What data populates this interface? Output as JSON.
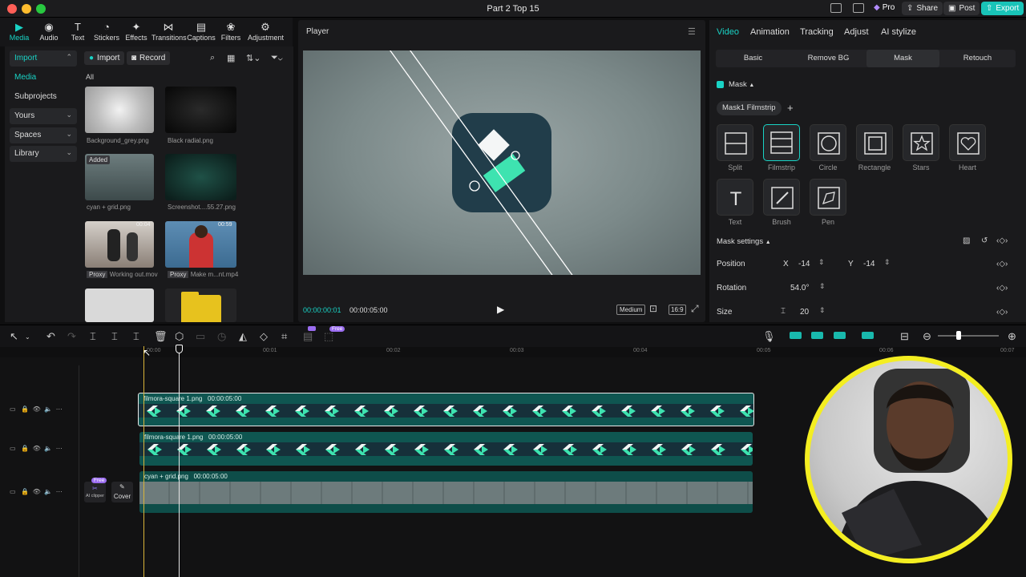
{
  "window": {
    "title": "Part 2 Top 15",
    "pro_label": "Pro",
    "share_label": "Share",
    "post_label": "Post",
    "export_label": "Export"
  },
  "toolbar": {
    "items": [
      {
        "label": "Media",
        "icon": "media-icon"
      },
      {
        "label": "Audio",
        "icon": "audio-icon"
      },
      {
        "label": "Text",
        "icon": "text-icon"
      },
      {
        "label": "Stickers",
        "icon": "stickers-icon"
      },
      {
        "label": "Effects",
        "icon": "effects-icon"
      },
      {
        "label": "Transitions",
        "icon": "transitions-icon"
      },
      {
        "label": "Captions",
        "icon": "captions-icon"
      },
      {
        "label": "Filters",
        "icon": "filters-icon"
      },
      {
        "label": "Adjustment",
        "icon": "adjustment-icon"
      }
    ]
  },
  "sidebar": {
    "items": [
      {
        "label": "Import"
      },
      {
        "label": "Media"
      },
      {
        "label": "Subprojects"
      },
      {
        "label": "Yours"
      },
      {
        "label": "Spaces"
      },
      {
        "label": "Library"
      }
    ]
  },
  "media": {
    "import_label": "Import",
    "record_label": "Record",
    "filter_all": "All",
    "items": [
      {
        "name": "Background_grey.png"
      },
      {
        "name": "Black radial.png"
      },
      {
        "name": "cyan + grid.png",
        "badge": "Added"
      },
      {
        "name": "Screenshot....55.27.png"
      },
      {
        "name": "Working out.mov",
        "badge": "Proxy",
        "duration": "00:04"
      },
      {
        "name": "Make m...nt.mp4",
        "badge": "Proxy",
        "duration": "00:59"
      }
    ]
  },
  "player": {
    "title": "Player",
    "current_time": "00:00:00:01",
    "total_time": "00:00:05:00",
    "quality": "Medium",
    "ratio": "16:9"
  },
  "inspector": {
    "tabs": [
      "Video",
      "Animation",
      "Tracking",
      "Adjust",
      "AI stylize"
    ],
    "subtabs": [
      "Basic",
      "Remove BG",
      "Mask",
      "Retouch"
    ],
    "mask_toggle_label": "Mask",
    "mask_chip": "Mask1 Filmstrip",
    "masks": [
      "Split",
      "Filmstrip",
      "Circle",
      "Rectangle",
      "Stars",
      "Heart",
      "Text",
      "Brush",
      "Pen"
    ],
    "settings_title": "Mask settings",
    "position_label": "Position",
    "x_label": "X",
    "x_value": "-14",
    "y_label": "Y",
    "y_value": "-14",
    "rotation_label": "Rotation",
    "rotation_value": "54.0°",
    "size_label": "Size",
    "size_value": "20"
  },
  "timeline": {
    "free_badge": "Free",
    "ruler": [
      "00:00",
      "00:01",
      "00:02",
      "00:03",
      "00:04",
      "00:05",
      "00:06",
      "00:07"
    ],
    "tracks": [
      {
        "clip_name": "filmora-square 1.png",
        "clip_duration": "00:00:05:00"
      },
      {
        "clip_name": "filmora-square 1.png",
        "clip_duration": "00:00:05:00"
      },
      {
        "clip_name": "cyan + grid.png",
        "clip_duration": "00:00:05:00"
      }
    ],
    "ai_clipper_label": "AI clipper",
    "cover_label": "Cover",
    "free_badge2": "Free"
  },
  "colors": {
    "accent": "#19d3c5",
    "clip": "#0f5651",
    "ring": "#f4ee21"
  }
}
